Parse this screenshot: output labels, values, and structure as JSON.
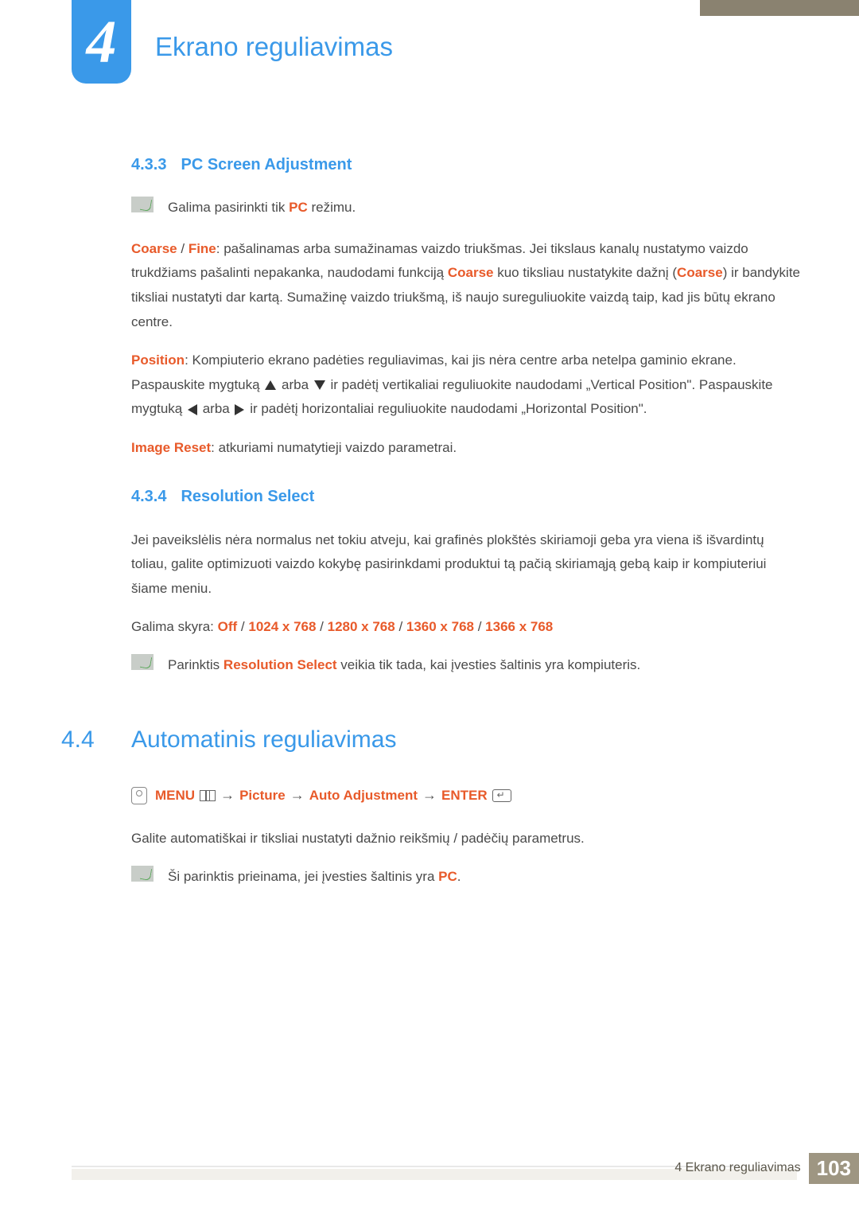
{
  "chapter": {
    "number": "4",
    "title": "Ekrano reguliavimas"
  },
  "s433": {
    "heading_num": "4.3.3",
    "heading_text": "PC Screen Adjustment",
    "note_prefix": "Galima pasirinkti tik ",
    "note_pc": "PC",
    "note_suffix": " režimu.",
    "coarse": "Coarse",
    "fine": "Fine",
    "p1_a": ": pašalinamas arba sumažinamas vaizdo triukšmas. Jei tikslaus kanalų nustatymo vaizdo trukdžiams pašalinti nepakanka, naudodami funkciją ",
    "p1_b": " kuo tiksliau nustatykite dažnį (",
    "p1_c": ") ir bandykite tiksliai nustatyti dar kartą. Sumažinę vaizdo triukšmą, iš naujo sureguliuokite vaizdą taip, kad jis būtų ekrano centre.",
    "position": "Position",
    "p2_a": ": Kompiuterio ekrano padėties reguliavimas, kai jis nėra centre arba netelpa gaminio ekrane. Paspauskite mygtuką ",
    "p2_b": " arba ",
    "p2_c": " ir padėtį vertikaliai reguliuokite naudodami „Vertical Position\". Paspauskite mygtuką ",
    "p2_d": " arba ",
    "p2_e": " ir padėtį horizontaliai reguliuokite naudodami „Horizontal Position\".",
    "image_reset": "Image Reset",
    "p3": ": atkuriami numatytieji vaizdo parametrai."
  },
  "s434": {
    "heading_num": "4.3.4",
    "heading_text": "Resolution Select",
    "p1": "Jei paveikslėlis nėra normalus net tokiu atveju, kai grafinės plokštės skiriamoji geba yra viena iš išvardintų toliau, galite optimizuoti vaizdo kokybę pasirinkdami produktui tą pačią skiriamąją gebą kaip ir kompiuteriui šiame meniu.",
    "options_label": "Galima skyra: ",
    "off": "Off",
    "r1": "1024 x 768",
    "r2": "1280 x 768",
    "r3": "1360 x 768",
    "r4": "1366 x 768",
    "sep": " / ",
    "note_a": "Parinktis ",
    "note_b": "Resolution Select",
    "note_c": " veikia tik tada, kai įvesties šaltinis yra kompiuteris."
  },
  "s44": {
    "num": "4.4",
    "title": "Automatinis reguliavimas",
    "menu": "MENU",
    "picture": "Picture",
    "auto": "Auto Adjustment",
    "enter": "ENTER",
    "arrow": "→",
    "p1": "Galite automatiškai ir tiksliai nustatyti dažnio reikšmių / padėčių parametrus.",
    "note_a": "Ši parinktis prieinama, jei įvesties šaltinis yra ",
    "note_pc": "PC",
    "note_b": "."
  },
  "footer": {
    "text": "4 Ekrano reguliavimas",
    "page": "103"
  }
}
